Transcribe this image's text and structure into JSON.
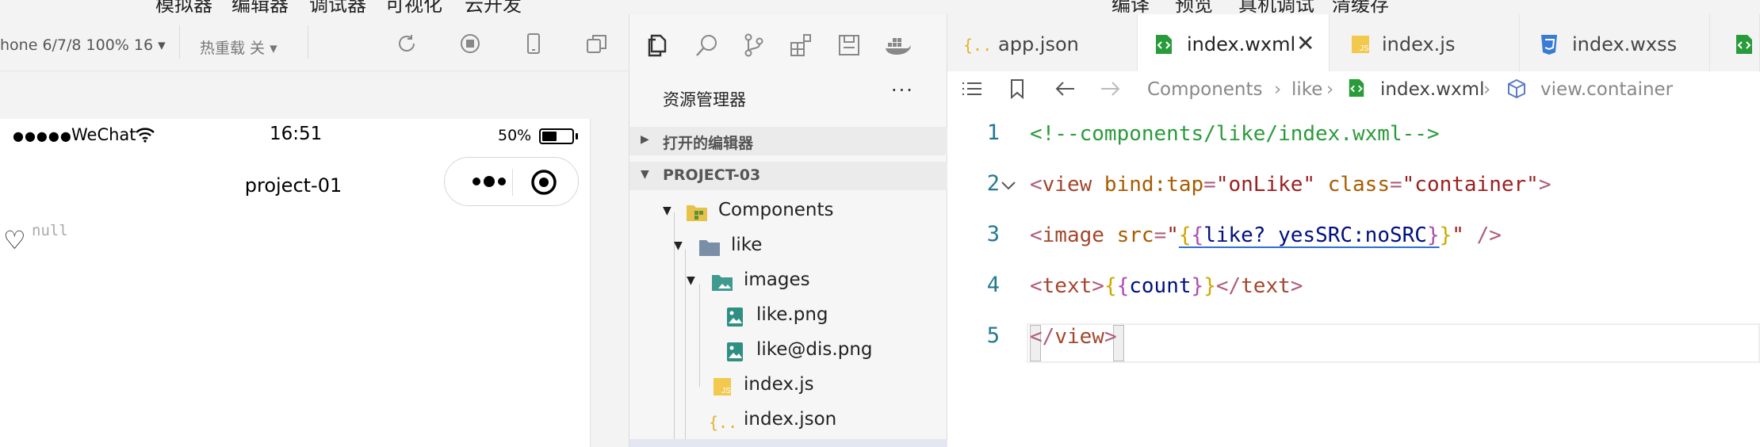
{
  "menubar": {
    "left": [
      "模拟器",
      "编辑器",
      "调试器",
      "可视化",
      "云开发"
    ],
    "right": [
      "编译",
      "预览",
      "真机调试",
      "清缓存"
    ]
  },
  "simulator_toolbar": {
    "device": "hone 6/7/8 100% 16 ▾",
    "hot_reload": "热重载 关 ▾"
  },
  "phone": {
    "carrier": "WeChat",
    "time": "16:51",
    "battery_pct": "50%",
    "battery_level": 0.5,
    "nav_title": "project-01",
    "heart": "♡",
    "null_text": "null"
  },
  "explorer": {
    "title": "资源管理器",
    "more": "···",
    "open_editors": "打开的编辑器",
    "project": "PROJECT-03",
    "tree": [
      "Components",
      "like",
      "images",
      "like.png",
      "like@dis.png",
      "index.js",
      "index.json"
    ]
  },
  "editor": {
    "tabs": [
      {
        "label": "app.json",
        "icon": "json-icon"
      },
      {
        "label": "index.wxml",
        "icon": "wxml-icon",
        "active": true
      },
      {
        "label": "index.js",
        "icon": "js-icon"
      },
      {
        "label": "index.wxss",
        "icon": "wxss-icon"
      }
    ],
    "breadcrumb": [
      "Components",
      "like",
      "index.wxml",
      "view.container"
    ],
    "line_numbers": [
      "1",
      "2",
      "3",
      "4",
      "5"
    ],
    "code": {
      "l1": "<!--components/like/index.wxml-->",
      "l2_open": "<",
      "l2_tag": "view",
      "l2_attr1": " bind:tap",
      "l2_eq1": "=",
      "l2_val1": "\"onLike\"",
      "l2_attr2": " class",
      "l2_eq2": "=",
      "l2_val2": "\"container\"",
      "l2_close": ">",
      "l3_open": "<",
      "l3_tag": "image",
      "l3_attr": " src",
      "l3_eq": "=",
      "l3_q1": "\"",
      "l3_b1": "{",
      "l3_b2": "{",
      "l3_expr": "like? yesSRC:noSRC",
      "l3_b3": "}",
      "l3_b4": "}",
      "l3_q2": "\"",
      "l3_end": " />",
      "l4_open": "<",
      "l4_tag": "text",
      "l4_gt": ">",
      "l4_b1": "{",
      "l4_b2": "{",
      "l4_var": "count",
      "l4_b3": "}",
      "l4_b4": "}",
      "l4_close_open": "</",
      "l4_close_tag": "text",
      "l4_close_gt": ">",
      "l5_open": "</",
      "l5_tag": "view",
      "l5_gt": ">"
    }
  },
  "colors": {
    "accent_blue": "#2f6ed3",
    "json_yellow": "#e5b12c",
    "wxml_green": "#2a9b3a"
  }
}
